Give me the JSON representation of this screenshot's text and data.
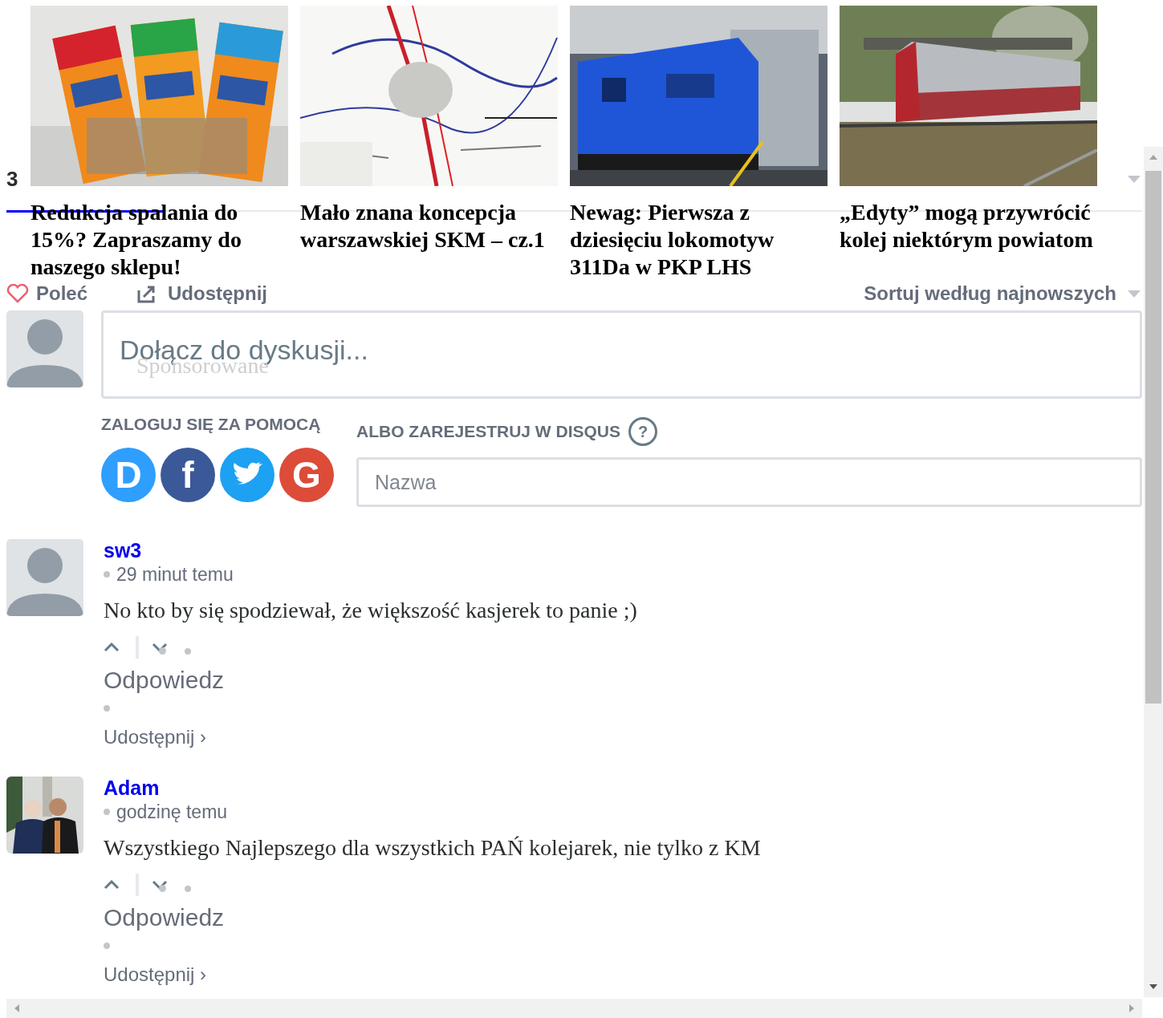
{
  "sponsored": {
    "label": "Sponsorowane",
    "cards": [
      {
        "title": "Redukcja spalania do 15%? Zapraszamy do naszego sklepu!"
      },
      {
        "title": "Mało znana koncepcja warszawskiej SKM – cz.1"
      },
      {
        "title": "Newag: Pierwsza z dziesięciu lokomotyw 311Da w PKP LHS"
      },
      {
        "title": "„Edyty” mogą przywrócić kolej niektórym powiatom"
      }
    ]
  },
  "header": {
    "comment_count": "3"
  },
  "actions": {
    "recommend": "Poleć",
    "share": "Udostępnij",
    "sort": "Sortuj według najnowszych"
  },
  "composer": {
    "placeholder": "Dołącz do dyskusji...",
    "login_label": "ZALOGUJ SIĘ ZA POMOCĄ",
    "providers": [
      {
        "kind": "disqus",
        "glyph": "D"
      },
      {
        "kind": "facebook",
        "glyph": "f"
      },
      {
        "kind": "twitter"
      },
      {
        "kind": "google",
        "glyph": "G"
      }
    ],
    "register_label": "ALBO ZAREJESTRUJ W DISQUS",
    "help": "?",
    "name_placeholder": "Nazwa"
  },
  "comments": [
    {
      "kind": "plain",
      "author": "sw3",
      "time": "29 minut temu",
      "text": "No kto by się spodziewał, że większość kasjerek to panie ;)",
      "reply": "Odpowiedz",
      "share": "Udostępnij ›"
    },
    {
      "author": "Adam",
      "time": "godzinę temu",
      "text": "Wszystkiego Najlepszego dla wszystkich PAŃ kolejarek, nie tylko z KM",
      "reply": "Odpowiedz",
      "share": "Udostępnij ›"
    }
  ]
}
